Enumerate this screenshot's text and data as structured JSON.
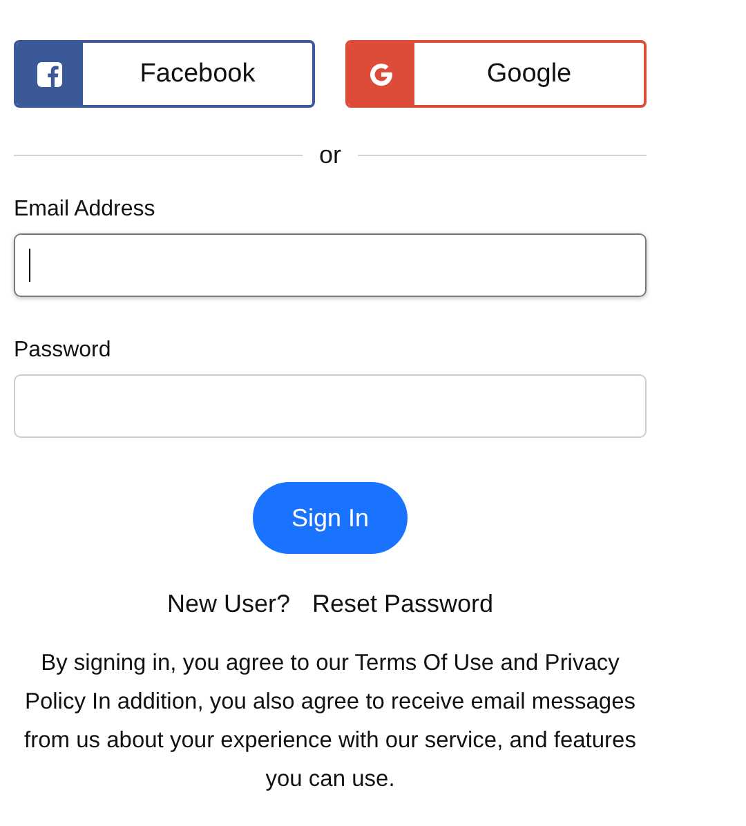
{
  "social_buttons": [
    {
      "kind": "facebook",
      "label": "Facebook"
    },
    {
      "kind": "google",
      "label": "Google"
    }
  ],
  "divider": "or",
  "fields": [
    {
      "label": "Email Address",
      "focused": true
    },
    {
      "label": "Password",
      "focused": false
    }
  ],
  "submit": "Sign In",
  "links": [
    "New User?",
    "Reset Password"
  ],
  "terms": "By signing in, you agree to our Terms Of Use and Privacy Policy In addition, you also agree to receive email messages from us about your experience with our service, and features you can use."
}
